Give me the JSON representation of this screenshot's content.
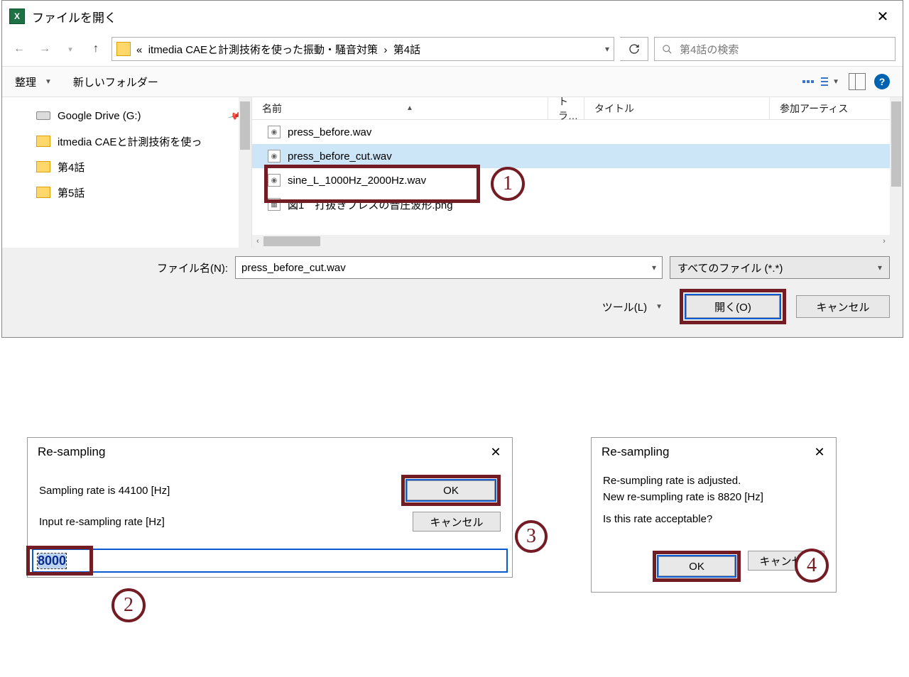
{
  "fileDialog": {
    "title": "ファイルを開く",
    "breadcrumb_prefix": "«",
    "breadcrumb1": "itmedia CAEと計測技術を使った振動・騒音対策",
    "breadcrumb2": "第4話",
    "search_placeholder": "第4話の検索",
    "organize": "整理",
    "newfolder": "新しいフォルダー",
    "sidebar": [
      {
        "label": "Google Drive (G:)",
        "icon": "disk",
        "pinned": true
      },
      {
        "label": "itmedia CAEと計測技術を使っ",
        "icon": "folder",
        "pinned": false
      },
      {
        "label": "第4話",
        "icon": "folder",
        "pinned": false
      },
      {
        "label": "第5話",
        "icon": "folder",
        "pinned": false
      }
    ],
    "columns": {
      "name": "名前",
      "track": "トラ…",
      "title": "タイトル",
      "artist": "参加アーティス"
    },
    "files": [
      {
        "name": "press_before.wav",
        "selected": false,
        "type": "wav"
      },
      {
        "name": "press_before_cut.wav",
        "selected": true,
        "type": "wav"
      },
      {
        "name": "sine_L_1000Hz_2000Hz.wav",
        "selected": false,
        "type": "wav"
      },
      {
        "name": "図1　打抜きプレスの音圧波形.png",
        "selected": false,
        "type": "png"
      }
    ],
    "filename_label": "ファイル名(N):",
    "filename_value": "press_before_cut.wav",
    "filter_value": "すべてのファイル (*.*)",
    "tools_label": "ツール(L)",
    "open_btn": "開く(O)",
    "cancel_btn": "キャンセル"
  },
  "annotations": {
    "n1": "1",
    "n2": "2",
    "n3": "3",
    "n4": "4"
  },
  "dlg1": {
    "title": "Re-sampling",
    "line1": "Sampling rate is 44100 [Hz]",
    "line2": "Input re-sampling rate [Hz]",
    "ok": "OK",
    "cancel": "キャンセル",
    "input_value": "8000"
  },
  "dlg2": {
    "title": "Re-sampling",
    "msg1": "Re-sumpling rate is adjusted.",
    "msg2": "New re-sumpling rate is 8820 [Hz]",
    "msg3": "Is this rate acceptable?",
    "ok": "OK",
    "cancel": "キャンセル"
  }
}
